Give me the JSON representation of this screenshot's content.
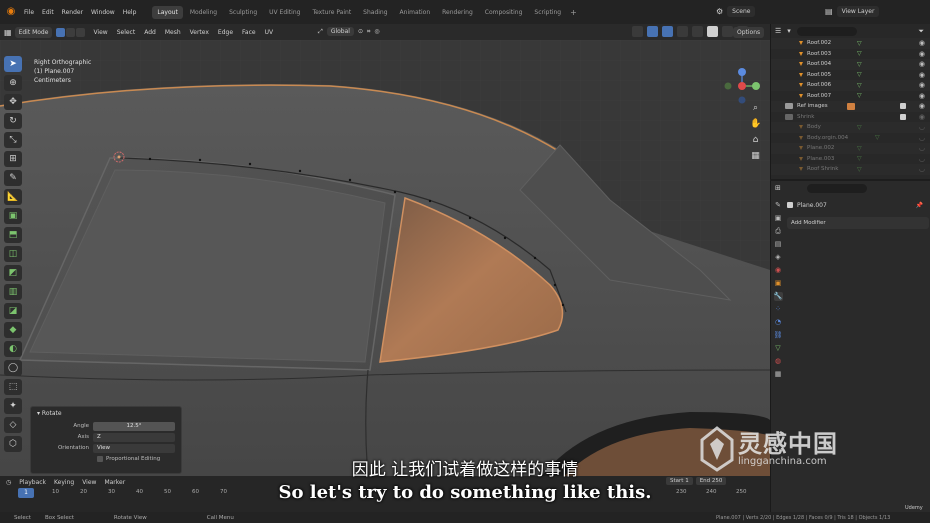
{
  "topbar": {
    "menu": [
      "File",
      "Edit",
      "Render",
      "Window",
      "Help"
    ],
    "tabs": [
      "Layout",
      "Modeling",
      "Sculpting",
      "UV Editing",
      "Texture Paint",
      "Shading",
      "Animation",
      "Rendering",
      "Compositing",
      "Scripting"
    ],
    "active_tab": "Layout",
    "scene": "Scene",
    "view_layer": "View Layer"
  },
  "viewport_header": {
    "mode": "Edit Mode",
    "menu": [
      "View",
      "Select",
      "Add",
      "Mesh",
      "Vertex",
      "Edge",
      "Face",
      "UV"
    ],
    "orientation": "Global",
    "options": "Options"
  },
  "viewport_info": {
    "view": "Right Orthographic",
    "object": "(1) Plane.007",
    "units": "Centimeters"
  },
  "operator_panel": {
    "title": "Rotate",
    "angle_label": "Angle",
    "angle_value": "12.5°",
    "axis_label": "Axis",
    "axis_value": "Z",
    "orientation_label": "Orientation",
    "orientation_value": "View",
    "proportional_label": "Proportional Editing"
  },
  "subtitles": {
    "chinese": "因此 让我们试着做这样的事情",
    "english": "So let's try to do something like this."
  },
  "watermark": {
    "cn": "灵感中国",
    "url": "lingganchina.com"
  },
  "timeline": {
    "menu": [
      "Playback",
      "Keying",
      "View",
      "Marker"
    ],
    "current_frame": "1",
    "ticks": [
      "10",
      "20",
      "30",
      "40",
      "50",
      "60",
      "70",
      "230",
      "240",
      "250"
    ],
    "start_label": "Start",
    "start_value": "1",
    "end_label": "End",
    "end_value": "250"
  },
  "statusbar": {
    "items": [
      "Select",
      "Box Select",
      "Rotate View",
      "Call Menu"
    ],
    "stats": "Plane.007 | Verts 2/20 | Edges 1/28 | Faces 0/9 | Tris 18 | Objects 1/13"
  },
  "outliner": {
    "rows": [
      {
        "name": "Roof.002",
        "dim": false
      },
      {
        "name": "Roof.003",
        "dim": false
      },
      {
        "name": "Roof.004",
        "dim": false
      },
      {
        "name": "Roof.005",
        "dim": false
      },
      {
        "name": "Roof.006",
        "dim": false
      },
      {
        "name": "Roof.007",
        "dim": false
      }
    ],
    "ref_images": "Ref images",
    "shrink": "Shrink",
    "shrink_rows": [
      "Body",
      "Body.orgin.004",
      "Plane.002",
      "Plane.003",
      "Roof Shrink"
    ]
  },
  "properties": {
    "object_name": "Plane.007",
    "add_modifier": "Add Modifier"
  },
  "colors": {
    "accent_blue": "#4772b3",
    "orange": "#e0902a",
    "panel_copper": "#b07a55"
  },
  "udemy": "Udemy"
}
